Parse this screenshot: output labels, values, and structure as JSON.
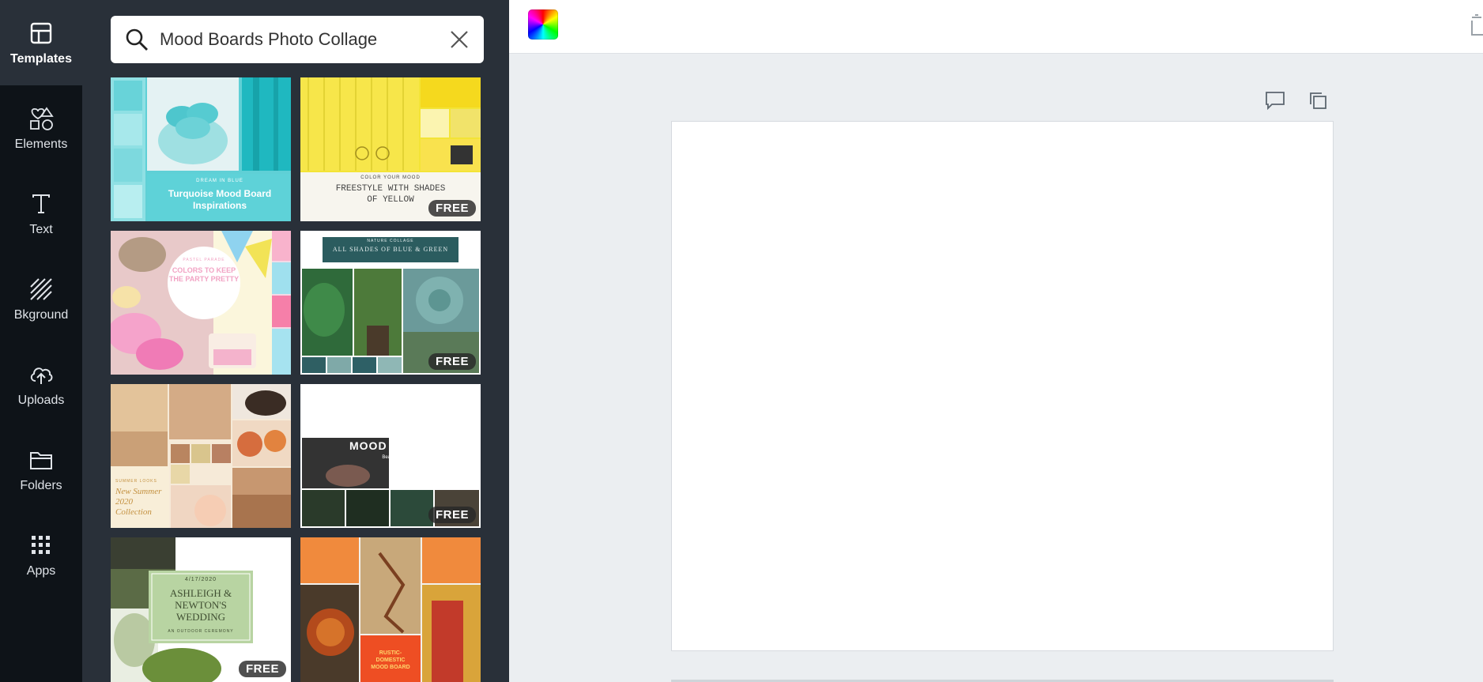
{
  "rail": {
    "items": [
      {
        "label": "Templates",
        "icon": "templates-icon",
        "active": true
      },
      {
        "label": "Elements",
        "icon": "elements-icon"
      },
      {
        "label": "Text",
        "icon": "text-icon"
      },
      {
        "label": "Bkground",
        "icon": "background-icon"
      },
      {
        "label": "Uploads",
        "icon": "uploads-icon"
      },
      {
        "label": "Folders",
        "icon": "folder-icon"
      },
      {
        "label": "Apps",
        "icon": "apps-icon"
      }
    ]
  },
  "search": {
    "value": "Mood Boards Photo Collage"
  },
  "templates": [
    {
      "text": "Turquoise Mood Board Inspirations",
      "kicker": "DREAM IN BLUE",
      "free": false
    },
    {
      "text": "FREESTYLE WITH SHADES OF YELLOW",
      "kicker": "COLOR YOUR MOOD",
      "free": true,
      "badge": "FREE"
    },
    {
      "text": "COLORS TO KEEP THE PARTY PRETTY",
      "kicker": "PASTEL PARADE",
      "free": false
    },
    {
      "text": "ALL SHADES OF BLUE & GREEN",
      "kicker": "NATURE COLLAGE",
      "free": true,
      "badge": "FREE"
    },
    {
      "text": "New Summer 2020 Collection",
      "kicker": "SUMMER LOOKS",
      "free": false
    },
    {
      "text": "MOOD",
      "kicker": "Beauty",
      "free": true,
      "badge": "FREE"
    },
    {
      "text": "ASHLEIGH & NEWTON'S WEDDING",
      "kicker": "AN OUTDOOR CEREMONY",
      "date": "4/17/2020",
      "free": true,
      "badge": "FREE"
    },
    {
      "text": "RUSTIC-DOMESTIC MOOD BOARD",
      "kicker": "",
      "free": false
    }
  ],
  "colors": {
    "rail_bg": "#0e1318",
    "panel_bg": "#293039",
    "editor_bg": "#ebeef1"
  }
}
